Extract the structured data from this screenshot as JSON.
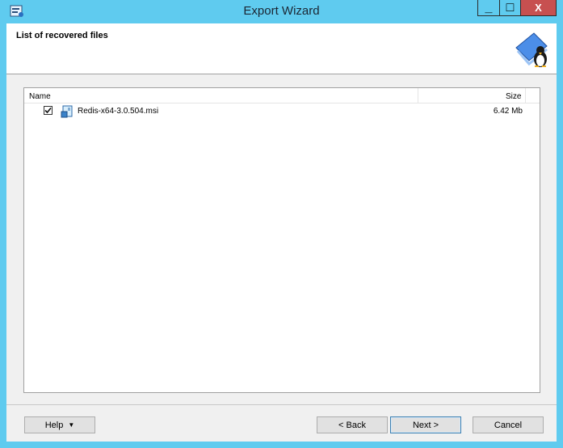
{
  "window": {
    "title": "Export Wizard",
    "controls": {
      "minimize": "_",
      "maximize": "□",
      "close": "X"
    }
  },
  "header": {
    "title": "List of recovered files",
    "icon": "wizard-book-penguin-icon"
  },
  "file_list": {
    "columns": [
      "Name",
      "Size"
    ],
    "rows": [
      {
        "checked": true,
        "icon": "msi-installer-icon",
        "name": "Redis-x64-3.0.504.msi",
        "size": "6.42 Mb"
      }
    ]
  },
  "buttons": {
    "help": "Help",
    "back": "< Back",
    "next": "Next >",
    "cancel": "Cancel"
  },
  "colors": {
    "frame": "#5fcbef",
    "close": "#c75050",
    "client": "#f0f0f0"
  }
}
